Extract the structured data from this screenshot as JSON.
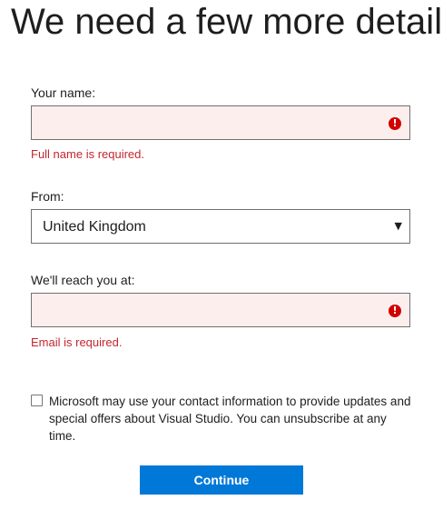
{
  "page": {
    "title": "We need a few more details"
  },
  "form": {
    "name": {
      "label": "Your name:",
      "value": "",
      "error_icon": "error-icon",
      "error": "Full name is required."
    },
    "country": {
      "label": "From:",
      "selected": "United Kingdom",
      "chevron_icon": "chevron-down-icon"
    },
    "email": {
      "label": "We'll reach you at:",
      "value": "",
      "error_icon": "error-icon",
      "error": "Email is required."
    },
    "consent": {
      "checked": false,
      "text": "Microsoft may use your contact information to provide updates and special offers about Visual Studio. You can unsubscribe at any time."
    },
    "submit_label": "Continue"
  },
  "colors": {
    "accent": "#0078d7",
    "error_text": "#c4262e",
    "error_icon": "#d00000",
    "invalid_field_bg": "#fdeeee"
  }
}
